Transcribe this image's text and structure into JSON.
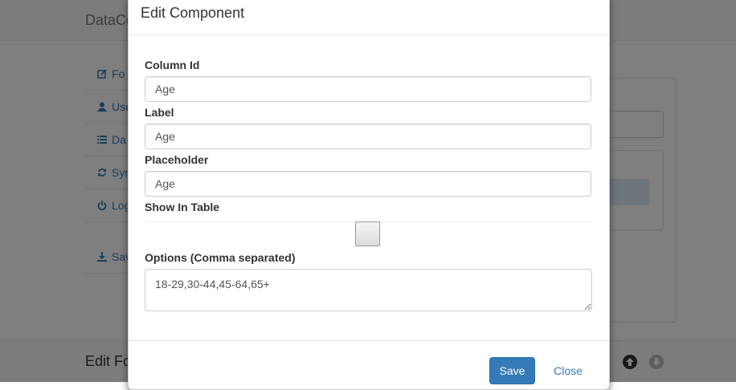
{
  "background": {
    "brand": "DataCo",
    "sidebar": [
      {
        "label": "Fo",
        "icon": "edit-icon"
      },
      {
        "label": "Use",
        "icon": "user-icon"
      },
      {
        "label": "Da",
        "icon": "list-icon"
      },
      {
        "label": "Syn",
        "icon": "refresh-icon"
      },
      {
        "label": "Log",
        "icon": "power-icon"
      },
      {
        "label": "Sav",
        "icon": "download-icon"
      }
    ],
    "footer_title": "Edit Fo",
    "colors": {
      "link": "#337ab7",
      "highlight": "#d9edf7"
    }
  },
  "modal": {
    "title": "Edit Component",
    "fields": {
      "column_id": {
        "label": "Column Id",
        "value": "Age"
      },
      "label": {
        "label": "Label",
        "value": "Age"
      },
      "placeholder": {
        "label": "Placeholder",
        "value": "Age"
      },
      "show_in_table": {
        "label": "Show In Table",
        "checked": false
      },
      "options": {
        "label": "Options (Comma separated)",
        "value": "18-29,30-44,45-64,65+"
      }
    },
    "buttons": {
      "save": "Save",
      "close": "Close"
    },
    "colors": {
      "primary": "#337ab7"
    }
  }
}
